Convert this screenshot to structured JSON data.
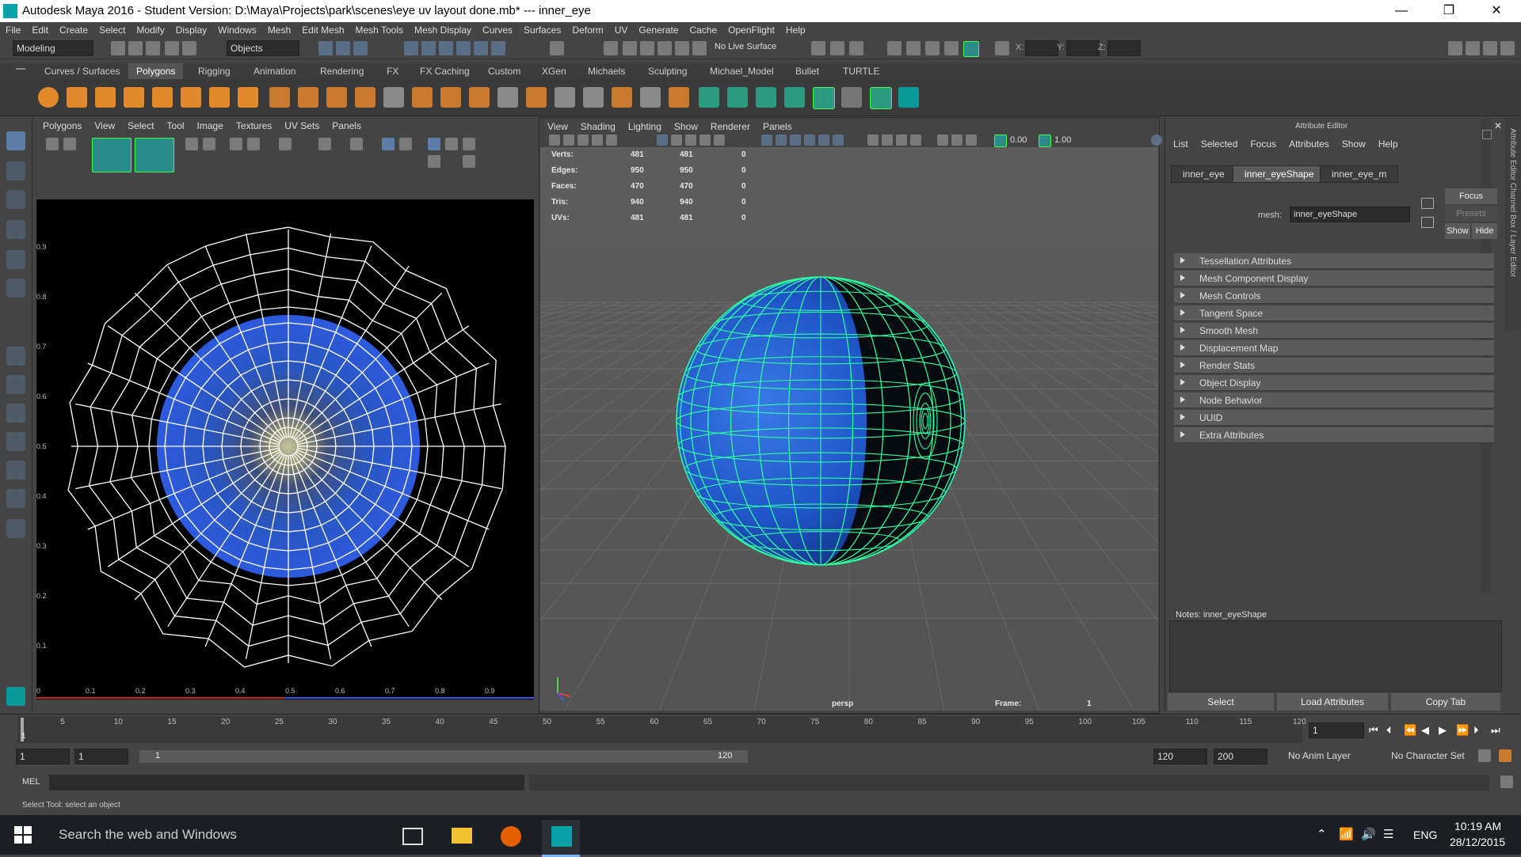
{
  "window": {
    "title": "Autodesk Maya 2016 - Student Version: D:\\Maya\\Projects\\park\\scenes\\eye uv layout done.mb*   ---   inner_eye",
    "min": "—",
    "max": "❐",
    "close": "✕"
  },
  "menubar": [
    "File",
    "Edit",
    "Create",
    "Select",
    "Modify",
    "Display",
    "Windows",
    "Mesh",
    "Edit Mesh",
    "Mesh Tools",
    "Mesh Display",
    "Curves",
    "Surfaces",
    "Deform",
    "UV",
    "Generate",
    "Cache",
    "OpenFlight",
    "Help"
  ],
  "status": {
    "mode": "Modeling",
    "selection_mode": "Objects",
    "live_surface": "No Live Surface",
    "x_label": "X:",
    "y_label": "Y:",
    "z_label": "Z:"
  },
  "shelf_tabs": [
    "Curves / Surfaces",
    "Polygons",
    "Rigging",
    "Animation",
    "Rendering",
    "FX",
    "FX Caching",
    "Custom",
    "XGen",
    "Michaels",
    "Sculpting",
    "Michael_Model",
    "Bullet",
    "TURTLE"
  ],
  "uv_editor": {
    "menu": [
      "Polygons",
      "View",
      "Select",
      "Tool",
      "Image",
      "Textures",
      "UV Sets",
      "Panels"
    ],
    "y_ticks": [
      "0.9",
      "0.8",
      "0.7",
      "0.6",
      "0.5",
      "0.4",
      "0.3",
      "0.2",
      "0.1"
    ],
    "x_ticks": [
      "0",
      "0.1",
      "0.2",
      "0.3",
      "0.4",
      "0.5",
      "0.6",
      "0.7",
      "0.8",
      "0.9"
    ]
  },
  "viewport": {
    "menu": [
      "View",
      "Shading",
      "Lighting",
      "Show",
      "Renderer",
      "Panels"
    ],
    "field1": "0.00",
    "field2": "1.00",
    "hud": [
      {
        "label": "Verts:",
        "a": "481",
        "b": "481",
        "c": "0"
      },
      {
        "label": "Edges:",
        "a": "950",
        "b": "950",
        "c": "0"
      },
      {
        "label": "Faces:",
        "a": "470",
        "b": "470",
        "c": "0"
      },
      {
        "label": "Tris:",
        "a": "940",
        "b": "940",
        "c": "0"
      },
      {
        "label": "UVs:",
        "a": "481",
        "b": "481",
        "c": "0"
      }
    ],
    "camera": "persp",
    "frame_label": "Frame:",
    "frame_value": "1"
  },
  "attribute_editor": {
    "title": "Attribute Editor",
    "menu": [
      "List",
      "Selected",
      "Focus",
      "Attributes",
      "Show",
      "Help"
    ],
    "tabs": [
      "inner_eye",
      "inner_eyeShape",
      "inner_eye_m"
    ],
    "mesh_label": "mesh:",
    "mesh_value": "inner_eyeShape",
    "focus_btn": "Focus",
    "presets_btn": "Presets",
    "show_btn": "Show",
    "hide_btn": "Hide",
    "sections": [
      "Tessellation Attributes",
      "Mesh Component Display",
      "Mesh Controls",
      "Tangent Space",
      "Smooth Mesh",
      "Displacement Map",
      "Render Stats",
      "Object Display",
      "Node Behavior",
      "UUID",
      "Extra Attributes"
    ],
    "notes_label": "Notes:  inner_eyeShape",
    "buttons": [
      "Select",
      "Load Attributes",
      "Copy Tab"
    ],
    "side_tabs": "Attribute Editor   Channel Box / Layer Editor"
  },
  "timeline": {
    "ticks": [
      "1",
      "5",
      "10",
      "15",
      "20",
      "25",
      "30",
      "35",
      "40",
      "45",
      "50",
      "55",
      "60",
      "65",
      "70",
      "75",
      "80",
      "85",
      "90",
      "95",
      "100",
      "105",
      "110",
      "115",
      "120"
    ],
    "current_frame": "1"
  },
  "range": {
    "start": "1",
    "start2": "1",
    "slider_start": "1",
    "slider_end": "120",
    "end": "120",
    "end2": "200",
    "anim_layer": "No Anim Layer",
    "char_set": "No Character Set"
  },
  "command": {
    "label": "MEL"
  },
  "help_line": "Select Tool: select an object",
  "taskbar": {
    "search": "Search the web and Windows",
    "lang": "ENG",
    "time": "10:19 AM",
    "date": "28/12/2015"
  }
}
